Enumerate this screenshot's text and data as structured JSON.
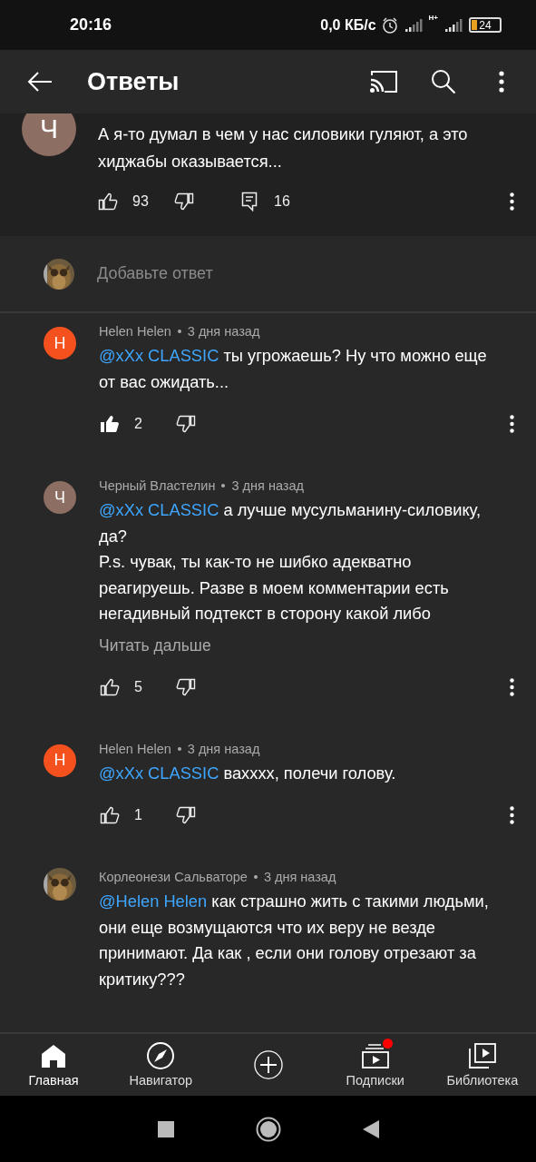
{
  "status_bar": {
    "time": "20:16",
    "net_speed": "0,0 КБ/с",
    "network_type": "H+",
    "battery": "24"
  },
  "header": {
    "title": "Ответы"
  },
  "parent_comment": {
    "avatar": {
      "kind": "letter",
      "letter": "Ч",
      "color": "#8d6e63"
    },
    "text": "А я-то думал в чем у нас силовики гуляют, а это хиджабы оказывается...",
    "likes": "93",
    "liked": false,
    "replies": "16"
  },
  "reply_box": {
    "placeholder": "Добавьте ответ"
  },
  "replies": [
    {
      "avatar": {
        "kind": "letter",
        "letter": "H",
        "color": "#f4511e"
      },
      "author": "Helen Helen",
      "time": "3 дня назад",
      "mention": "@xXx CLASSIC",
      "text": "ты угрожаешь? Ну что можно еще от вас ожидать...",
      "likes": "2",
      "liked": true
    },
    {
      "avatar": {
        "kind": "letter",
        "letter": "Ч",
        "color": "#8d6e63"
      },
      "author": "Черный Властелин",
      "time": "3 дня назад",
      "mention": "@xXx CLASSIC",
      "text": "а лучше мусульманину-силовику, да?\nP.s. чувак, ты как-то не шибко адекватно реагируешь. Разве в моем комментарии есть негадивный подтекст в сторону какой либо",
      "read_more": "Читать дальше",
      "likes": "5",
      "liked": false
    },
    {
      "avatar": {
        "kind": "letter",
        "letter": "H",
        "color": "#f4511e"
      },
      "author": "Helen Helen",
      "time": "3 дня назад",
      "mention": "@xXx CLASSIC",
      "text": "вахxxx, полечи голову.",
      "likes": "1",
      "liked": false
    },
    {
      "author": "Корлеонези Сальваторе",
      "time": "3 дня назад",
      "mention": "@Helen Helen",
      "text": "как страшно жить с такими людьми, они еще возмущаются что их веру не везде принимают. Да как , если они голову отрезают за критику???"
    }
  ],
  "bottom_nav": [
    {
      "kind": "home",
      "label": "Главная",
      "selected": true
    },
    {
      "kind": "explore",
      "label": "Навигатор",
      "selected": false
    },
    {
      "kind": "create",
      "selected": false
    },
    {
      "kind": "subscriptions",
      "label": "Подписки",
      "selected": false,
      "notification": true
    },
    {
      "kind": "library",
      "label": "Библиотека",
      "selected": false
    }
  ]
}
